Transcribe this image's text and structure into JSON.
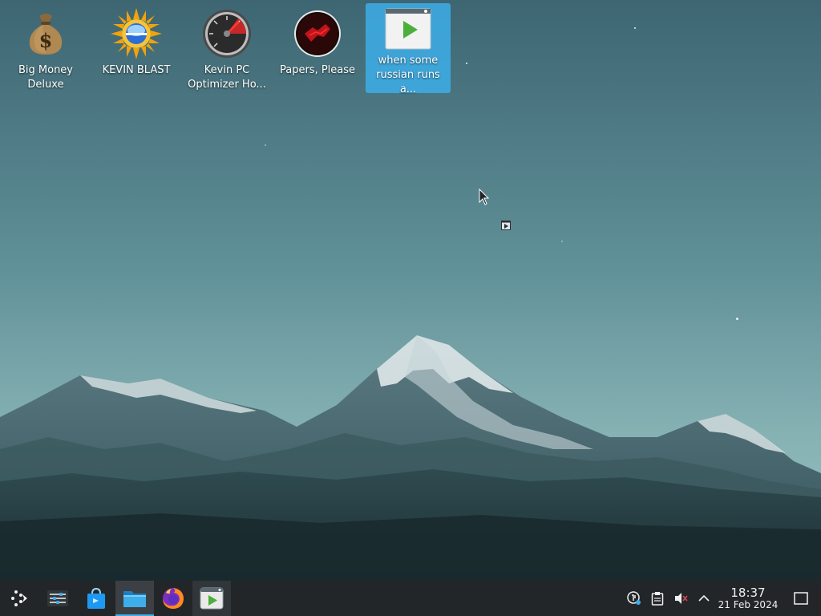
{
  "desktop": {
    "icons": [
      {
        "label_line1": "Big Money",
        "label_line2": "Deluxe",
        "icon": "money-bag-icon",
        "selected": false
      },
      {
        "label_line1": "KEVIN BLAST",
        "label_line2": "",
        "icon": "sun-globe-icon",
        "selected": false
      },
      {
        "label_line1": "Kevin PC",
        "label_line2": "Optimizer Ho...",
        "icon": "speedometer-icon",
        "selected": false
      },
      {
        "label_line1": "Papers, Please",
        "label_line2": "",
        "icon": "papers-please-icon",
        "selected": false
      },
      {
        "label_line1": "when some",
        "label_line2": "russian runs a...",
        "icon": "video-player-icon",
        "selected": true
      }
    ]
  },
  "taskbar": {
    "launchers": [
      {
        "name": "application-launcher",
        "icon": "kde-launcher-icon"
      },
      {
        "name": "system-settings",
        "icon": "sliders-icon"
      },
      {
        "name": "discover",
        "icon": "shopping-bag-icon"
      },
      {
        "name": "dolphin",
        "icon": "folder-icon"
      },
      {
        "name": "firefox",
        "icon": "firefox-icon"
      },
      {
        "name": "media-player",
        "icon": "video-player-icon"
      }
    ],
    "tray": [
      {
        "name": "network",
        "icon": "network-icon"
      },
      {
        "name": "clipboard",
        "icon": "clipboard-icon"
      },
      {
        "name": "volume",
        "icon": "volume-muted-icon"
      },
      {
        "name": "expand",
        "icon": "chevron-up-icon"
      }
    ],
    "clock": {
      "time": "18:37",
      "date": "21 Feb 2024"
    }
  },
  "colors": {
    "taskbar_bg": "#232629",
    "selection": "#3daee9",
    "text": "#eff0f1"
  }
}
